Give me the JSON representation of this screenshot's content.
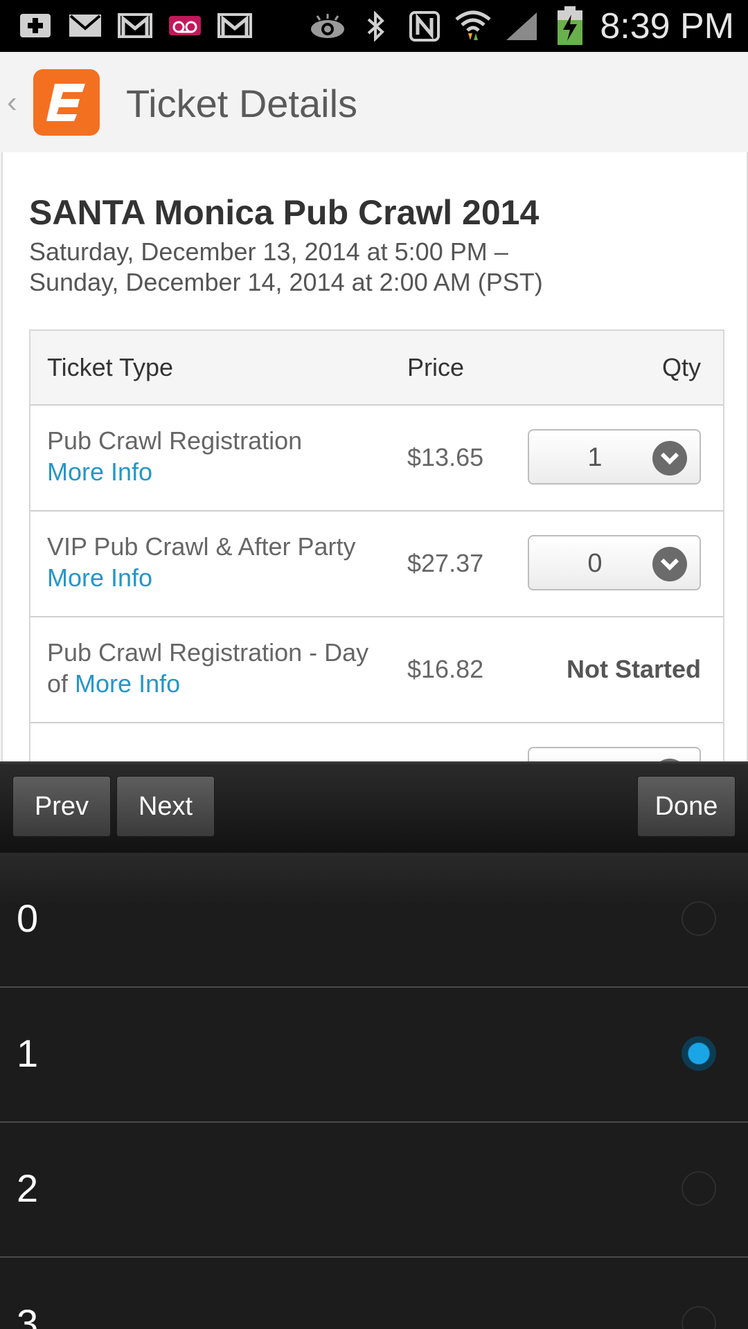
{
  "status_bar": {
    "left_icons": [
      "plus-icon",
      "mail-icon",
      "gmail-icon",
      "voicemail-icon",
      "gmail-icon"
    ],
    "right_icons": [
      "eye-icon",
      "bluetooth-icon",
      "nfc-icon",
      "wifi-icon",
      "signal-icon",
      "battery-charging-icon"
    ],
    "time": "8:39 PM"
  },
  "action_bar": {
    "app_logo_letter": "E",
    "title": "Ticket Details",
    "accent_color": "#f37021"
  },
  "event": {
    "title": "SANTA Monica Pub Crawl 2014",
    "date_line1": "Saturday, December 13, 2014 at 5:00 PM –",
    "date_line2": "Sunday, December 14, 2014 at 2:00 AM (PST)"
  },
  "tickets": {
    "headers": {
      "type": "Ticket Type",
      "price": "Price",
      "qty": "Qty"
    },
    "rows": [
      {
        "name": "Pub Crawl Registration",
        "more_info": "More Info",
        "price": "$13.65",
        "qty": "1"
      },
      {
        "name": "VIP Pub Crawl & After Party",
        "more_info": "More Info",
        "price": "$27.37",
        "qty": "0"
      },
      {
        "name": "Pub Crawl Registration - Day of",
        "more_info": "More Info",
        "price": "$16.82",
        "status": "Not Started"
      }
    ]
  },
  "nav": {
    "prev": "Prev",
    "next": "Next",
    "done": "Done"
  },
  "picker": {
    "options": [
      "0",
      "1",
      "2",
      "3"
    ],
    "selected": "1"
  }
}
